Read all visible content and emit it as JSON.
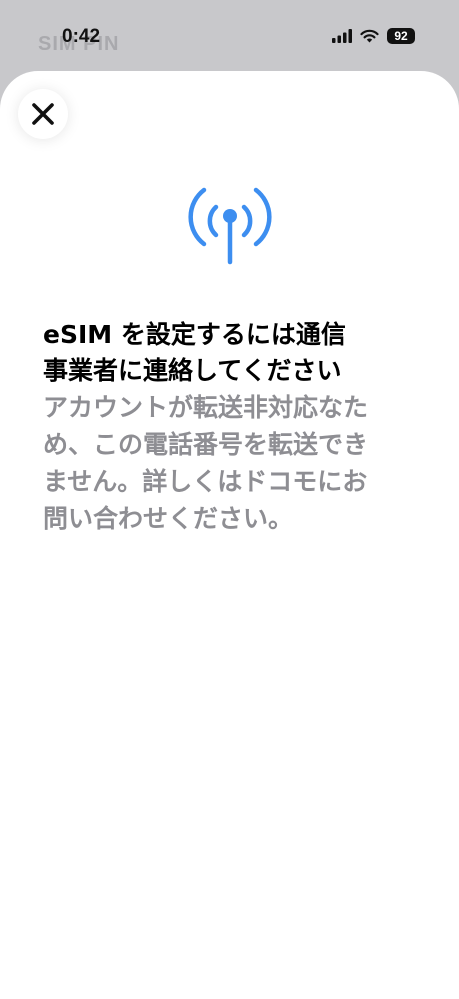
{
  "status_bar": {
    "time": "0:42",
    "battery": "92",
    "behind_text": "SIM PIN"
  },
  "sheet": {
    "close_icon": "close-icon",
    "hero_icon": "antenna-signal-icon",
    "title_line1": "eSIM を設定するには通信",
    "title_line2": "事業者に連絡してください",
    "body_lines": [
      "アカウントが転送非対応なた",
      "め、この電話番号を転送でき",
      "ません。詳しくはドコモにお",
      "問い合わせください。"
    ]
  },
  "colors": {
    "accent": "#3d8ef0",
    "secondary_text": "#8e8e93",
    "title_text": "#000000"
  }
}
